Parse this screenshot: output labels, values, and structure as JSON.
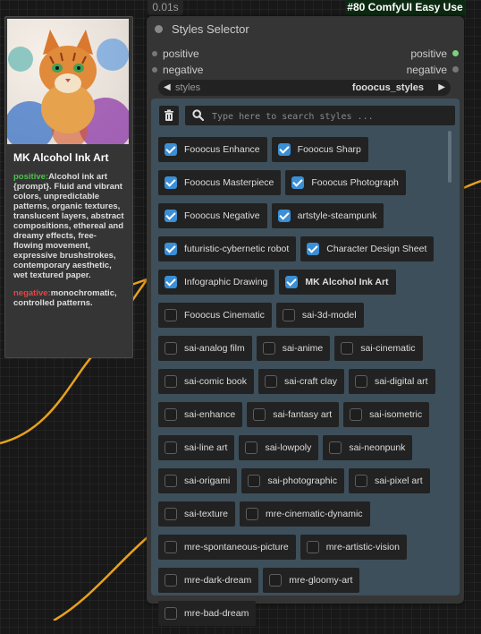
{
  "top": {
    "timer": "0.01s",
    "badge": "#80 ComfyUI Easy Use"
  },
  "preview": {
    "title": "MK Alcohol Ink Art",
    "positive_label": "positive:",
    "positive_text": "Alcohol ink art {prompt}. Fluid and vibrant colors, unpredictable patterns, organic textures, translucent layers, abstract compositions, ethereal and dreamy effects, free-flowing movement, expressive brushstrokes, contemporary aesthetic, wet textured paper.",
    "negative_label": "negative:",
    "negative_text": "monochromatic, controlled patterns."
  },
  "node": {
    "title": "Styles Selector",
    "inputs": [
      "positive",
      "negative"
    ],
    "outputs": [
      "positive",
      "negative"
    ],
    "output_colors": [
      "#7ed07e",
      "#777777"
    ],
    "combo": {
      "label": "styles",
      "value": "fooocus_styles"
    },
    "search_placeholder": "Type here to search styles ...",
    "styles": [
      {
        "label": "Fooocus Enhance",
        "checked": true
      },
      {
        "label": "Fooocus Sharp",
        "checked": true
      },
      {
        "label": "Fooocus Masterpiece",
        "checked": true
      },
      {
        "label": "Fooocus Photograph",
        "checked": true
      },
      {
        "label": "Fooocus Negative",
        "checked": true
      },
      {
        "label": "artstyle-steampunk",
        "checked": true
      },
      {
        "label": "futuristic-cybernetic robot",
        "checked": true
      },
      {
        "label": "Character Design Sheet",
        "checked": true
      },
      {
        "label": "Infographic Drawing",
        "checked": true
      },
      {
        "label": "MK Alcohol Ink Art",
        "checked": true,
        "highlight": true
      },
      {
        "label": "Fooocus Cinematic",
        "checked": false
      },
      {
        "label": "sai-3d-model",
        "checked": false
      },
      {
        "label": "sai-analog film",
        "checked": false
      },
      {
        "label": "sai-anime",
        "checked": false
      },
      {
        "label": "sai-cinematic",
        "checked": false
      },
      {
        "label": "sai-comic book",
        "checked": false
      },
      {
        "label": "sai-craft clay",
        "checked": false
      },
      {
        "label": "sai-digital art",
        "checked": false
      },
      {
        "label": "sai-enhance",
        "checked": false
      },
      {
        "label": "sai-fantasy art",
        "checked": false
      },
      {
        "label": "sai-isometric",
        "checked": false
      },
      {
        "label": "sai-line art",
        "checked": false
      },
      {
        "label": "sai-lowpoly",
        "checked": false
      },
      {
        "label": "sai-neonpunk",
        "checked": false
      },
      {
        "label": "sai-origami",
        "checked": false
      },
      {
        "label": "sai-photographic",
        "checked": false
      },
      {
        "label": "sai-pixel art",
        "checked": false
      },
      {
        "label": "sai-texture",
        "checked": false
      },
      {
        "label": "mre-cinematic-dynamic",
        "checked": false
      },
      {
        "label": "mre-spontaneous-picture",
        "checked": false
      },
      {
        "label": "mre-artistic-vision",
        "checked": false
      },
      {
        "label": "mre-dark-dream",
        "checked": false
      },
      {
        "label": "mre-gloomy-art",
        "checked": false
      },
      {
        "label": "mre-bad-dream",
        "checked": false
      }
    ]
  },
  "colors": {
    "wire": "#e8a21c",
    "panel": "#3d4f5a",
    "checkbox": "#3a8fd6"
  }
}
